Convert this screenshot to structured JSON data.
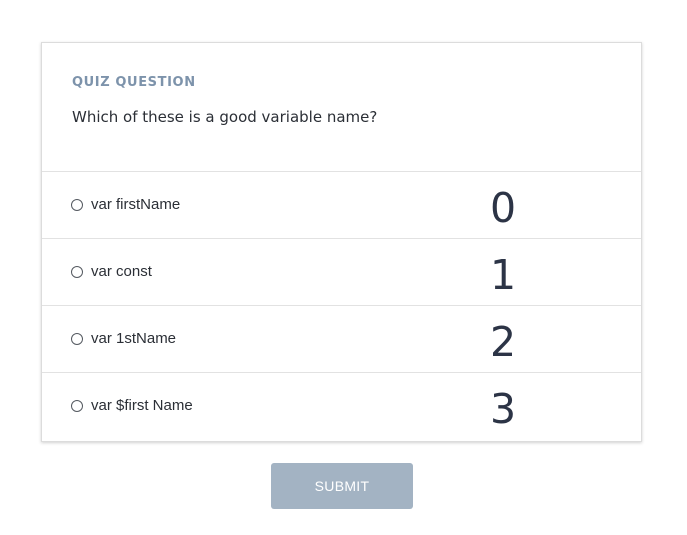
{
  "quiz": {
    "eyebrow": "QUIZ QUESTION",
    "question": "Which of these is a good variable name?",
    "options": [
      {
        "label": "var firstName",
        "index": "0"
      },
      {
        "label": "var const",
        "index": "1"
      },
      {
        "label": "var 1stName",
        "index": "2"
      },
      {
        "label": "var $first Name",
        "index": "3"
      }
    ],
    "submit_label": "SUBMIT"
  },
  "colors": {
    "eyebrow": "#7d93ab",
    "submit_bg": "#a3b3c3",
    "index_text": "#2c3446"
  }
}
